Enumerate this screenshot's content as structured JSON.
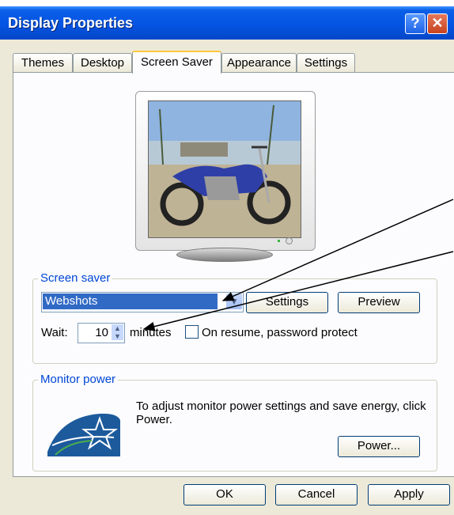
{
  "window": {
    "title": "Display Properties"
  },
  "titlebar": {
    "help_glyph": "?",
    "close_glyph": "✕"
  },
  "tabs": [
    {
      "label": "Themes",
      "active": false
    },
    {
      "label": "Desktop",
      "active": false
    },
    {
      "label": "Screen Saver",
      "active": true
    },
    {
      "label": "Appearance",
      "active": false
    },
    {
      "label": "Settings",
      "active": false
    }
  ],
  "screen_saver": {
    "group_label": "Screen saver",
    "selected": "Webshots",
    "settings_label": "Settings",
    "preview_label": "Preview",
    "wait_label": "Wait:",
    "wait_value": "10",
    "minutes_label": "minutes",
    "password_label": "On resume, password protect",
    "password_checked": false
  },
  "monitor_power": {
    "group_label": "Monitor power",
    "description": "To adjust monitor power settings and save energy, click Power.",
    "power_label": "Power...",
    "logo_icon": "energy-star-logo"
  },
  "footer": {
    "ok": "OK",
    "cancel": "Cancel",
    "apply": "Apply"
  },
  "colors": {
    "title_bar": "#0554e3",
    "dialog_bg": "#ece9d8",
    "panel_bg": "#fcfcfe",
    "group_label": "#0046d5",
    "selection": "#316ac5",
    "arrow": "#000000"
  },
  "preview_image": "motorcycle-on-beach"
}
